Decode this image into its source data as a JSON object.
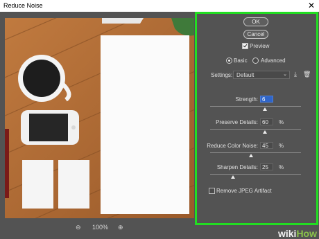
{
  "window": {
    "title": "Reduce Noise",
    "close_glyph": "✕"
  },
  "zoom": {
    "value": "100%",
    "minus": "⊖",
    "plus": "⊕"
  },
  "buttons": {
    "ok": "OK",
    "cancel": "Cancel"
  },
  "preview": {
    "label": "Preview",
    "checked": true
  },
  "mode": {
    "basic": "Basic",
    "advanced": "Advanced",
    "selected": "Basic"
  },
  "settings": {
    "label": "Settings:",
    "value": "Default"
  },
  "sliders": [
    {
      "label": "Strength:",
      "value": "6",
      "unit": "",
      "level": 0.6
    },
    {
      "label": "Preserve Details:",
      "value": "60",
      "unit": "%",
      "level": 0.6
    },
    {
      "label": "Reduce Color Noise:",
      "value": "45",
      "unit": "%",
      "level": 0.45
    },
    {
      "label": "Sharpen Details:",
      "value": "25",
      "unit": "%",
      "level": 0.25
    }
  ],
  "remove_jpeg": {
    "label": "Remove JPEG Artifact",
    "checked": false
  },
  "watermark": {
    "wiki": "wiki",
    "how": "How"
  },
  "colors": {
    "highlight": "#22dd22",
    "panel": "#535353",
    "active_field": "#2f65c9"
  }
}
